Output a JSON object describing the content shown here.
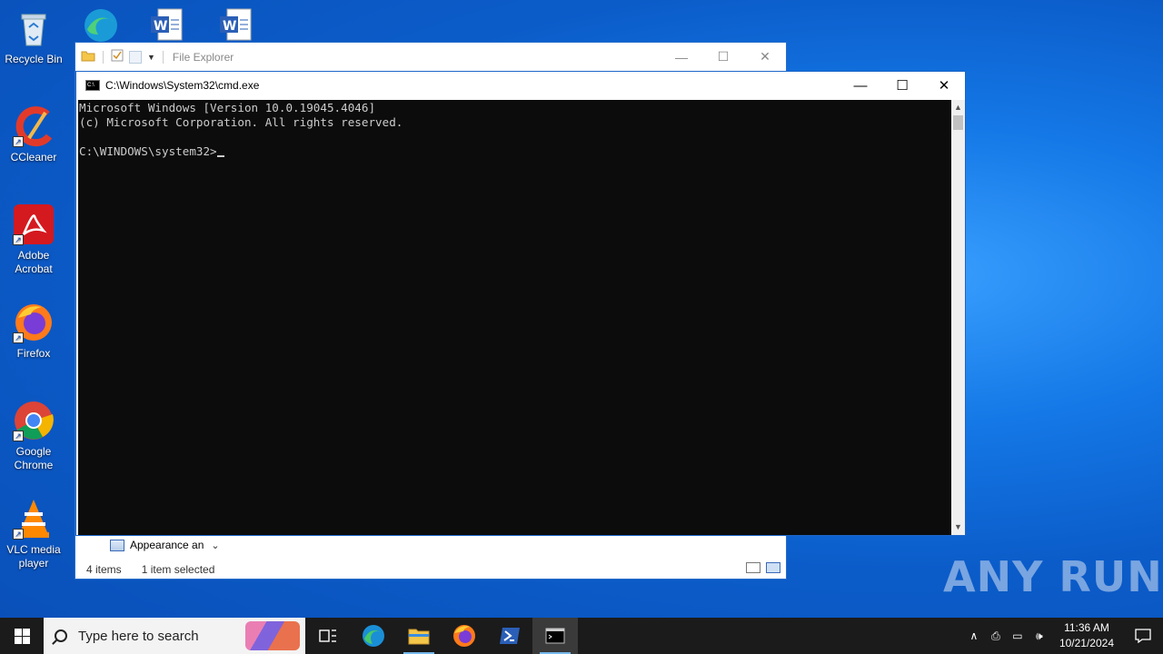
{
  "desktop": {
    "icons": [
      {
        "label": "Recycle Bin"
      },
      {
        "label": "CCleaner"
      },
      {
        "label": "Adobe Acrobat"
      },
      {
        "label": "Firefox"
      },
      {
        "label": "Google Chrome"
      },
      {
        "label": "VLC media player"
      }
    ]
  },
  "explorer": {
    "title": "File Explorer",
    "selected_item": "Appearance an",
    "status_items": "4 items",
    "status_selected": "1 item selected"
  },
  "cmd": {
    "title": "C:\\Windows\\System32\\cmd.exe",
    "line1": "Microsoft Windows [Version 10.0.19045.4046]",
    "line2": "(c) Microsoft Corporation. All rights reserved.",
    "line3": "",
    "prompt": "C:\\WINDOWS\\system32>"
  },
  "taskbar": {
    "search_placeholder": "Type here to search",
    "time": "11:36 AM",
    "date": "10/21/2024"
  },
  "watermark": "ANY RUN",
  "colors": {
    "desktop_accent": "#0b5cc9",
    "taskbar_bg": "#1b1b1b",
    "console_bg": "#0c0c0c",
    "console_fg": "#cccccc",
    "active_underline": "#76b9ed"
  }
}
